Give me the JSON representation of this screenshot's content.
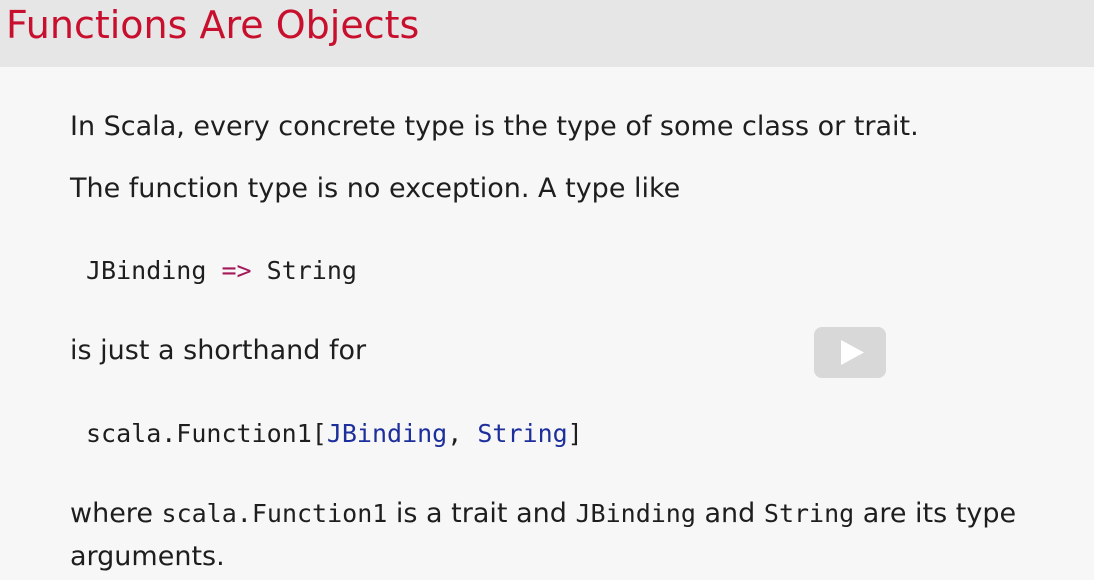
{
  "slide": {
    "title": "Functions Are Objects",
    "para1": "In Scala, every concrete type is the type of some class or trait.",
    "para2": "The function type is no exception. A type like",
    "code1": {
      "lhs": "JBinding",
      "arrow": "=>",
      "rhs": "String"
    },
    "para3": "is just a shorthand for",
    "code2": {
      "prefix": "scala.Function1[",
      "arg1": "JBinding",
      "sep": ", ",
      "arg2": "String",
      "suffix": "]"
    },
    "para4": {
      "w1": "where",
      "c1": "scala.Function1",
      "w2": "is a trait and",
      "c2": "JBinding",
      "w3": "and",
      "c3": "String",
      "w4": "are its type",
      "line2": "arguments."
    }
  },
  "video": {
    "play_icon": "play-icon"
  },
  "colors": {
    "title": "#c8102e",
    "arrow": "#a31a5b",
    "type_arg": "#1c2f9c"
  }
}
